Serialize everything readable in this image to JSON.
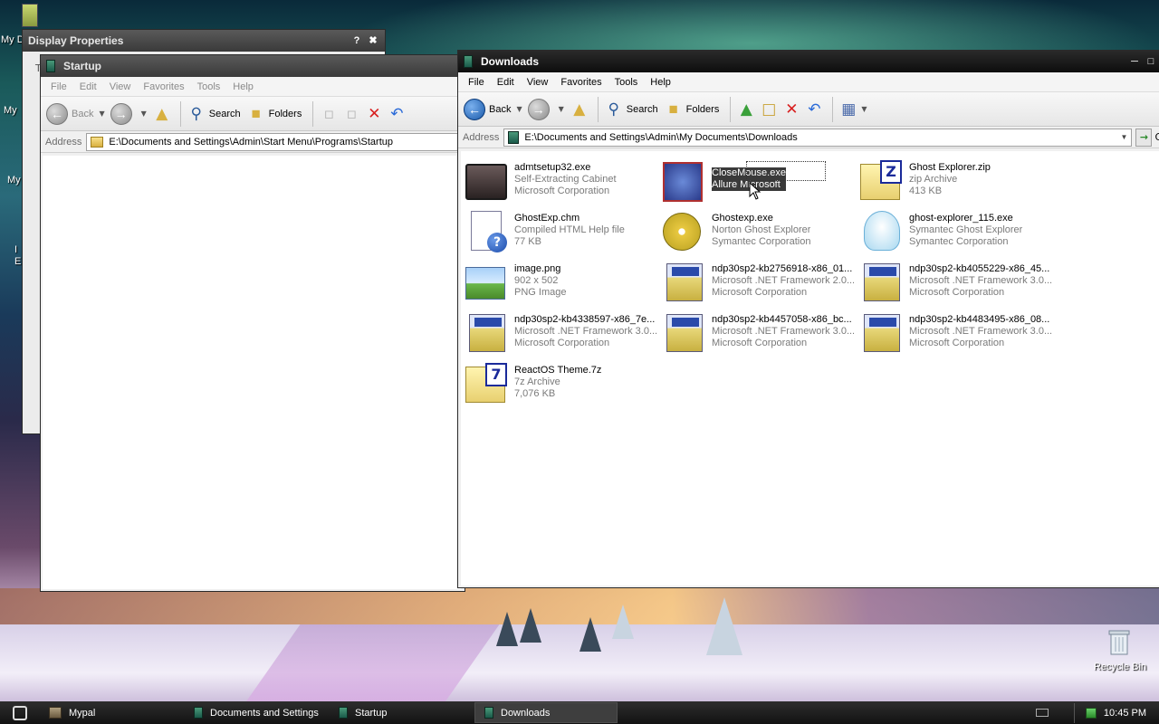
{
  "desktop": {
    "labels": [
      "My D",
      "My",
      "My",
      "I",
      "E"
    ],
    "recycle_bin": "Recycle Bin"
  },
  "display_properties": {
    "title": "Display Properties",
    "help_btn": "?",
    "close_btn": "✖",
    "tab_stub": "T"
  },
  "startup_window": {
    "title": "Startup",
    "menu": [
      "File",
      "Edit",
      "View",
      "Favorites",
      "Tools",
      "Help"
    ],
    "toolbar": {
      "back": "Back",
      "search": "Search",
      "folders": "Folders"
    },
    "address_label": "Address",
    "address": "E:\\Documents and Settings\\Admin\\Start Menu\\Programs\\Startup"
  },
  "downloads_window": {
    "title": "Downloads",
    "menu": [
      "File",
      "Edit",
      "View",
      "Favorites",
      "Tools",
      "Help"
    ],
    "toolbar": {
      "back": "Back",
      "search": "Search",
      "folders": "Folders"
    },
    "address_label": "Address",
    "address": "E:\\Documents and Settings\\Admin\\My Documents\\Downloads",
    "go_label": "G",
    "files": [
      {
        "name": "admtsetup32.exe",
        "line2": "Self-Extracting Cabinet",
        "line3": "Microsoft Corporation",
        "icon": "installer-icon"
      },
      {
        "name": "CloseMouse.exe",
        "line2": "Allure Microsoft",
        "line3": "",
        "icon": "application-icon",
        "selected": true
      },
      {
        "name": "Ghost Explorer.zip",
        "line2": "zip Archive",
        "line3": "413 KB",
        "icon": "zip-archive-icon",
        "badge": "Z"
      },
      {
        "name": "GhostExp.chm",
        "line2": "Compiled HTML Help file",
        "line3": "77 KB",
        "icon": "help-file-icon"
      },
      {
        "name": "Ghostexp.exe",
        "line2": "Norton Ghost Explorer",
        "line3": "Symantec Corporation",
        "icon": "ghost-disc-icon"
      },
      {
        "name": "ghost-explorer_115.exe",
        "line2": "Symantec Ghost Explorer",
        "line3": "Symantec Corporation",
        "icon": "ghost-icon"
      },
      {
        "name": "image.png",
        "line2": "902 x 502",
        "line3": "PNG Image",
        "icon": "image-icon"
      },
      {
        "name": "ndp30sp2-kb2756918-x86_01...",
        "line2": "Microsoft .NET Framework 2.0...",
        "line3": "Microsoft Corporation",
        "icon": "setup-icon"
      },
      {
        "name": "ndp30sp2-kb4055229-x86_45...",
        "line2": "Microsoft .NET Framework 3.0...",
        "line3": "Microsoft Corporation",
        "icon": "setup-icon"
      },
      {
        "name": "ndp30sp2-kb4338597-x86_7e...",
        "line2": "Microsoft .NET Framework 3.0...",
        "line3": "Microsoft Corporation",
        "icon": "setup-icon"
      },
      {
        "name": "ndp30sp2-kb4457058-x86_bc...",
        "line2": "Microsoft .NET Framework 3.0...",
        "line3": "Microsoft Corporation",
        "icon": "setup-icon"
      },
      {
        "name": "ndp30sp2-kb4483495-x86_08...",
        "line2": "Microsoft .NET Framework 3.0...",
        "line3": "Microsoft Corporation",
        "icon": "setup-icon"
      },
      {
        "name": "ReactOS Theme.7z",
        "line2": "7z Archive",
        "line3": "7,076 KB",
        "icon": "7z-archive-icon",
        "badge": "7"
      }
    ]
  },
  "taskbar": {
    "tasks": [
      {
        "label": "Mypal",
        "active": false
      },
      {
        "label": "Documents and Settings",
        "active": false
      },
      {
        "label": "Startup",
        "active": false
      },
      {
        "label": "Downloads",
        "active": true
      }
    ],
    "clock": "10:45 PM"
  }
}
